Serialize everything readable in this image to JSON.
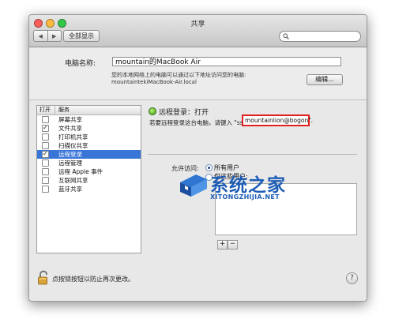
{
  "window": {
    "title": "共享",
    "show_all_label": "全部显示",
    "nav_back": "◀",
    "nav_forward": "▶",
    "traffic_light_colors": [
      "#fc605c",
      "#fdbc40",
      "#34c84a"
    ]
  },
  "computer_name": {
    "label": "电脑名称:",
    "value": "mountain的MacBook Air",
    "description_line1": "您的本地网络上的电脑可以通过以下地址访问您的电脑:",
    "description_line2": "mountaintekiMacBook-Air.local",
    "edit_button": "编辑..."
  },
  "services": {
    "header_on": "打开",
    "header_service": "服务",
    "items": [
      {
        "label": "屏幕共享",
        "checked": false,
        "selected": false
      },
      {
        "label": "文件共享",
        "checked": true,
        "selected": false
      },
      {
        "label": "打印机共享",
        "checked": false,
        "selected": false
      },
      {
        "label": "扫描仪共享",
        "checked": false,
        "selected": false
      },
      {
        "label": "远程登录",
        "checked": true,
        "selected": true
      },
      {
        "label": "远程管理",
        "checked": false,
        "selected": false
      },
      {
        "label": "远程 Apple 事件",
        "checked": false,
        "selected": false
      },
      {
        "label": "互联网共享",
        "checked": false,
        "selected": false
      },
      {
        "label": "蓝牙共享",
        "checked": false,
        "selected": false
      }
    ]
  },
  "detail": {
    "status": "远程登录：打开",
    "connect_text": "若要远程登录这台电脑，请键入 \"ssh",
    "ssh_address": "mountainlion@bogon\".",
    "allow_label": "允许访问:",
    "radio_all": "所有用户",
    "radio_only": "仅这些用户:",
    "add_button": "+",
    "remove_button": "−",
    "status_color": "#3b9b18",
    "highlight_color": "#e02020"
  },
  "footer": {
    "lock_text": "点按锁按钮以防止再次更改。",
    "help_label": "?"
  },
  "watermark": {
    "name": "系统之家",
    "url": "XITONGZHIJIA.NET",
    "color": "#1e5db5"
  }
}
